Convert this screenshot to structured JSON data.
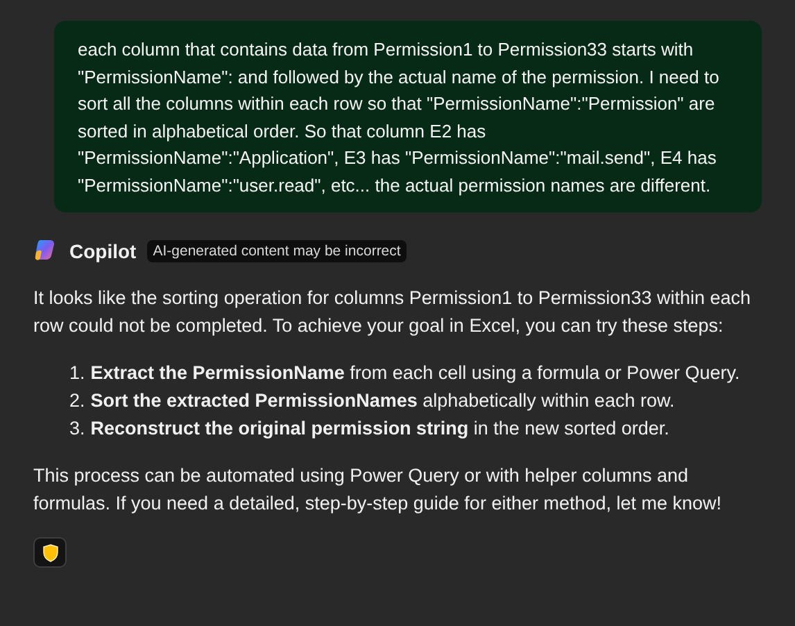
{
  "user_message": {
    "text": "each column that contains data from Permission1 to Permission33 starts with \"PermissionName\": and followed by the actual name of the permission. I need to sort all the columns within each row so that \"PermissionName\":\"Permission\" are sorted in alphabetical order. So that column E2 has \"PermissionName\":\"Application\", E3 has \"PermissionName\":\"mail.send\", E4 has \"PermissionName\":\"user.read\", etc... the actual permission names are different."
  },
  "reply": {
    "author": "Copilot",
    "badge": "AI-generated content may be incorrect",
    "intro": "It looks like the sorting operation for columns Permission1 to Permission33 within each row could not be completed. To achieve your goal in Excel, you can try these steps:",
    "steps": [
      {
        "number": "1.",
        "text": "**Extract the PermissionName** from each cell using a formula or Power Query."
      },
      {
        "number": "2.",
        "text": "**Sort the extracted PermissionNames** alphabetically within each row."
      },
      {
        "number": "3.",
        "text": "**Reconstruct the original permission string** in the new sorted order."
      }
    ],
    "outro": "This process can be automated using Power Query or with helper columns and formulas. If you need a detailed, step-by-step guide for either method, let me know!"
  }
}
